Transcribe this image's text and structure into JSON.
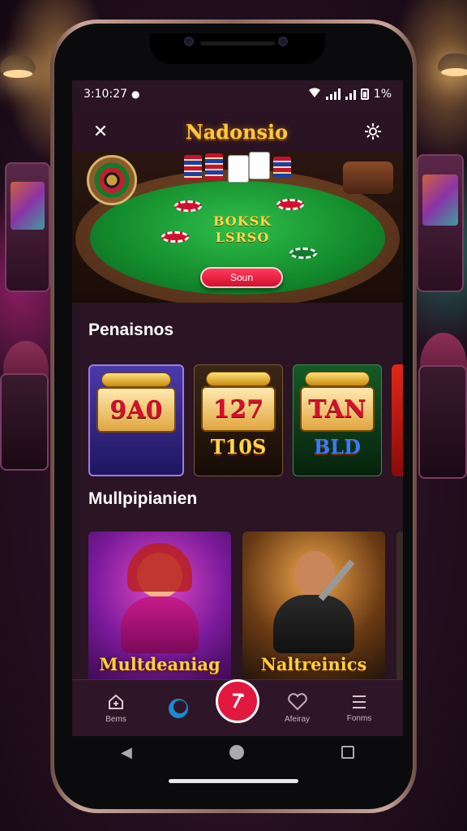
{
  "status_bar": {
    "time": "3:10:27",
    "battery_text": "1%"
  },
  "header": {
    "title": "Nadonsio",
    "close_icon": "close-icon",
    "settings_icon": "gear-icon"
  },
  "banner": {
    "felt_line_1": "BOKSK",
    "felt_line_2": "LSRSO",
    "cta_label": "Soun"
  },
  "sections": {
    "slots_title": "Penaisnos",
    "multiplayer_title": "Mullpipianien"
  },
  "slots": [
    {
      "reel": "9A0",
      "sub": "",
      "theme": "#3a2a8a"
    },
    {
      "reel": "127",
      "sub": "T10S",
      "theme": "#2a1a1a"
    },
    {
      "reel": "TAN",
      "sub": "BLD",
      "theme": "#0f3a1a"
    }
  ],
  "multiplayer": [
    {
      "label": "Multdeaniag",
      "theme": "#8a1a9a"
    },
    {
      "label": "Naltreinics",
      "theme": "#3a2a18"
    }
  ],
  "bottom_nav": [
    {
      "label": "Bems",
      "icon": "home-icon"
    },
    {
      "label": "",
      "icon": "spin-icon"
    },
    {
      "label": "",
      "icon": "center-action-icon"
    },
    {
      "label": "Afeiray",
      "icon": "heart-icon"
    },
    {
      "label": "Fonms",
      "icon": "menu-icon"
    }
  ],
  "colors": {
    "accent_gold": "#ffc83d",
    "accent_red": "#e1193f",
    "screen_bg": "#2b1424"
  }
}
